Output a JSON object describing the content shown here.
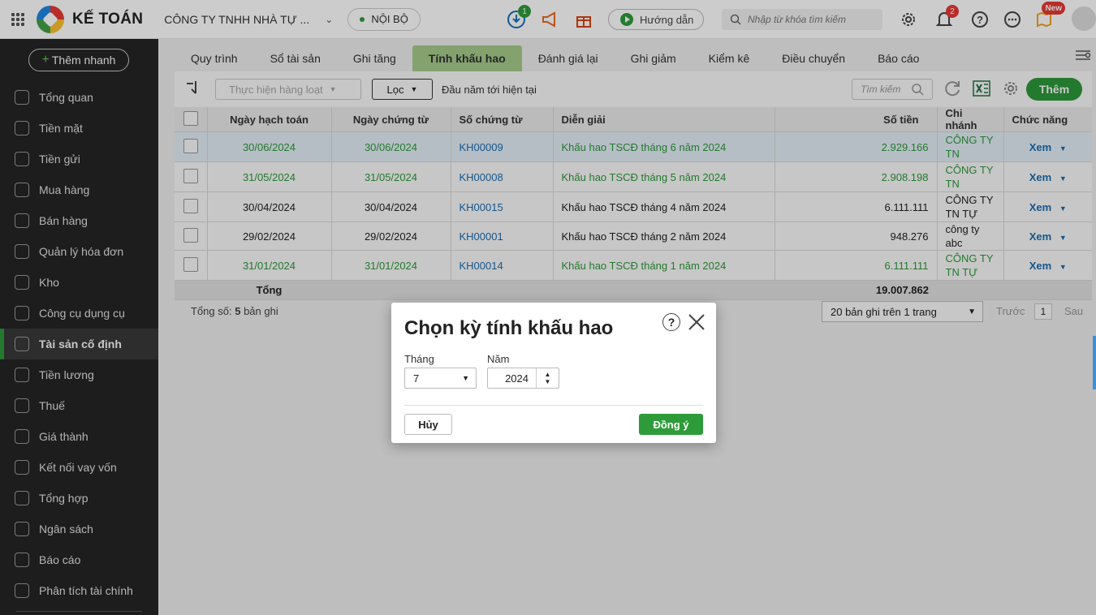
{
  "header": {
    "brand": "KẾ TOÁN",
    "company": "CÔNG TY TNHH NHÀ TỰ ...",
    "scope": "NỘI BỘ",
    "download_badge": "1",
    "guide": "Hướng dẫn",
    "search_placeholder": "Nhập từ khóa tìm kiếm",
    "notification_badge": "2",
    "new_badge": "New"
  },
  "sidebar": {
    "quick_add": "Thêm nhanh",
    "items": [
      {
        "label": "Tổng quan",
        "icon": "gauge-icon"
      },
      {
        "label": "Tiền mặt",
        "icon": "money-bag-icon"
      },
      {
        "label": "Tiền gửi",
        "icon": "bank-icon"
      },
      {
        "label": "Mua hàng",
        "icon": "shopping-bag-icon"
      },
      {
        "label": "Bán hàng",
        "icon": "cart-icon"
      },
      {
        "label": "Quản lý hóa đơn",
        "icon": "invoice-icon"
      },
      {
        "label": "Kho",
        "icon": "warehouse-icon"
      },
      {
        "label": "Công cụ dụng cụ",
        "icon": "tools-icon"
      },
      {
        "label": "Tài sản cố định",
        "icon": "car-icon"
      },
      {
        "label": "Tiền lương",
        "icon": "payroll-icon"
      },
      {
        "label": "Thuế",
        "icon": "tax-icon"
      },
      {
        "label": "Giá thành",
        "icon": "price-tag-icon"
      },
      {
        "label": "Kết nối vay vốn",
        "icon": "loan-icon"
      },
      {
        "label": "Tổng hợp",
        "icon": "summary-icon"
      },
      {
        "label": "Ngân sách",
        "icon": "budget-icon"
      },
      {
        "label": "Báo cáo",
        "icon": "bar-chart-icon"
      },
      {
        "label": "Phân tích tài chính",
        "icon": "analytics-icon"
      }
    ]
  },
  "tabs": [
    "Quy trình",
    "Sổ tài sản",
    "Ghi tăng",
    "Tính khấu hao",
    "Đánh giá lại",
    "Ghi giảm",
    "Kiểm kê",
    "Điều chuyển",
    "Báo cáo"
  ],
  "toolbar": {
    "bulk": "Thực hiện hàng loạt",
    "filter": "Lọc",
    "range": "Đầu năm tới hiện tại",
    "search_placeholder": "Tìm kiếm",
    "add": "Thêm"
  },
  "table": {
    "headers": [
      "Ngày hạch toán",
      "Ngày chứng từ",
      "Số chứng từ",
      "Diễn giải",
      "Số tiền",
      "Chi nhánh",
      "Chức năng"
    ],
    "rows": [
      {
        "posting_date": "30/06/2024",
        "doc_date": "30/06/2024",
        "doc_no": "KH00009",
        "desc": "Khấu hao TSCĐ tháng 6 năm 2024",
        "amount": "2.929.166",
        "branch": "CÔNG TY TN ATHENA",
        "action": "Xem"
      },
      {
        "posting_date": "31/05/2024",
        "doc_date": "31/05/2024",
        "doc_no": "KH00008",
        "desc": "Khấu hao TSCĐ tháng 5 năm 2024",
        "amount": "2.908.198",
        "branch": "CÔNG TY TN ATHENA",
        "action": "Xem"
      },
      {
        "posting_date": "30/04/2024",
        "doc_date": "30/04/2024",
        "doc_no": "KH00015",
        "desc": "Khấu hao TSCĐ tháng 4 năm 2024",
        "amount": "6.111.111",
        "branch": "CÔNG TY TN TỰ ĐỘNG V",
        "action": "Xem"
      },
      {
        "posting_date": "29/02/2024",
        "doc_date": "29/02/2024",
        "doc_no": "KH00001",
        "desc": "Khấu hao TSCĐ tháng 2 năm 2024",
        "amount": "948.276",
        "branch": "công ty abc",
        "action": "Xem"
      },
      {
        "posting_date": "31/01/2024",
        "doc_date": "31/01/2024",
        "doc_no": "KH00014",
        "desc": "Khấu hao TSCĐ tháng 1 năm 2024",
        "amount": "6.111.111",
        "branch": "CÔNG TY TN TỰ ĐỘNG V",
        "action": "Xem"
      }
    ],
    "total_label": "Tổng",
    "total_amount": "19.007.862"
  },
  "footer": {
    "total_prefix": "Tổng số:",
    "total_count": "5",
    "total_suffix": "bản ghi",
    "page_size": "20 bản ghi trên 1 trang",
    "prev": "Trước",
    "page": "1",
    "next": "Sau"
  },
  "dialog": {
    "title": "Chọn kỳ tính khấu hao",
    "month_label": "Tháng",
    "month_value": "7",
    "year_label": "Năm",
    "year_value": "2024",
    "cancel": "Hủy",
    "ok": "Đồng ý"
  },
  "colors": {
    "accent": "#2e9b3a",
    "link": "#1a6fb5",
    "sidebar": "#262626"
  }
}
